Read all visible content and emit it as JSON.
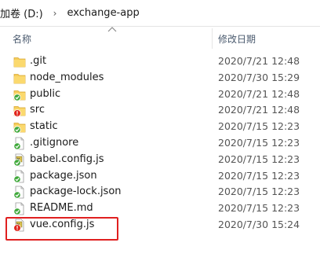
{
  "breadcrumb": {
    "drive": "加卷 (D:)",
    "folder": "exchange-app"
  },
  "columns": {
    "name": "名称",
    "date": "修改日期"
  },
  "files": [
    {
      "name": ".git",
      "date": "2020/7/21 12:48",
      "icon": "folder-icon"
    },
    {
      "name": "node_modules",
      "date": "2020/7/30 15:29",
      "icon": "folder-icon"
    },
    {
      "name": "public",
      "date": "2020/7/21 12:48",
      "icon": "folder-synced-icon"
    },
    {
      "name": "src",
      "date": "2020/7/21 12:48",
      "icon": "folder-error-icon"
    },
    {
      "name": "static",
      "date": "2020/7/15 12:23",
      "icon": "folder-synced-icon"
    },
    {
      "name": ".gitignore",
      "date": "2020/7/15 12:23",
      "icon": "file-synced-icon"
    },
    {
      "name": "babel.config.js",
      "date": "2020/7/15 12:23",
      "icon": "js-file-synced-icon"
    },
    {
      "name": "package.json",
      "date": "2020/7/15 12:23",
      "icon": "file-synced-icon"
    },
    {
      "name": "package-lock.json",
      "date": "2020/7/15 12:23",
      "icon": "file-synced-icon"
    },
    {
      "name": "README.md",
      "date": "2020/7/15 12:23",
      "icon": "file-synced-icon"
    },
    {
      "name": "vue.config.js",
      "date": "2020/7/30 15:24",
      "icon": "js-file-modified-icon"
    }
  ],
  "highlight_color": "#e02020"
}
